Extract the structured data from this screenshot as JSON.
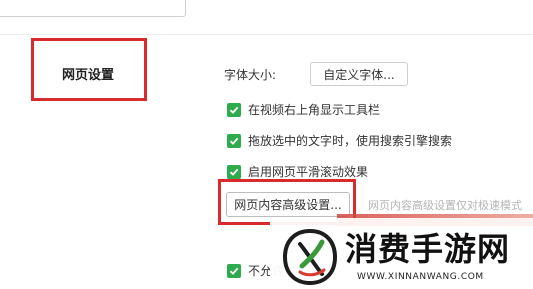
{
  "section": {
    "title": "网页设置"
  },
  "font_size": {
    "label": "字体大小:",
    "button_label": "自定义字体..."
  },
  "options": [
    {
      "label": "在视频右上角显示工具栏",
      "checked": true
    },
    {
      "label": "拖放选中的文字时，使用搜索引擎搜索",
      "checked": true
    },
    {
      "label": "启用网页平滑滚动效果",
      "checked": true
    },
    {
      "label": "不允许",
      "checked": true
    }
  ],
  "advanced": {
    "button_label": "网页内容高级设置...",
    "hint": "网页内容高级设置仅对极速模式"
  },
  "watermark": {
    "title": "消费手游网",
    "url": "WWW.XINNANWANG.COM"
  },
  "colors": {
    "highlight_red": "#d92b2b",
    "checkbox_green": "#2eab4d"
  }
}
